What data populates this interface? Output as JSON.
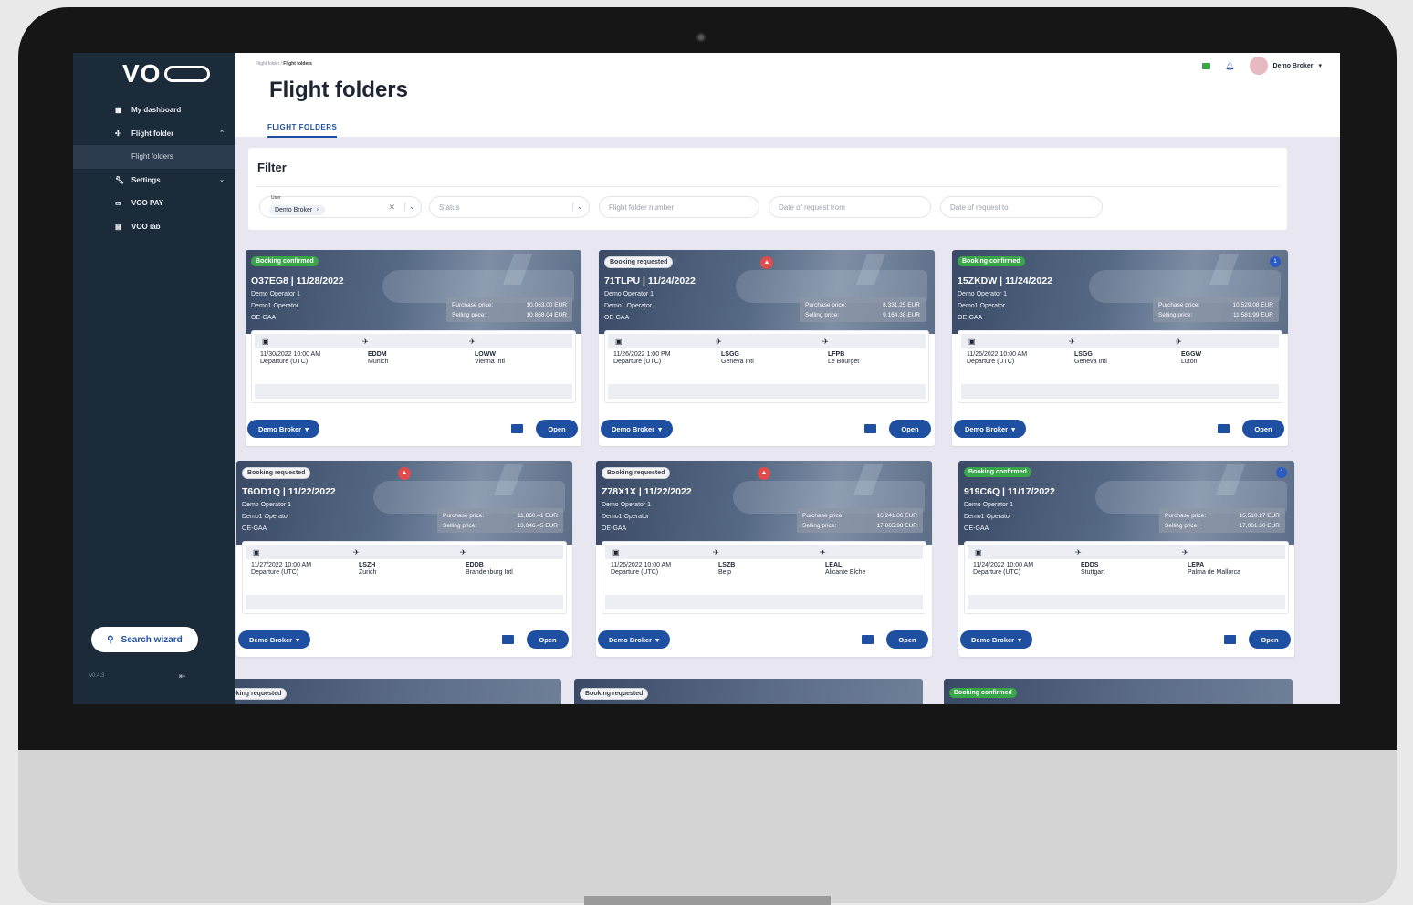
{
  "sidebar": {
    "logo": "VO",
    "items": [
      {
        "label": "My dashboard",
        "icon": "dashboard-icon"
      },
      {
        "label": "Flight folder",
        "icon": "flight-folder-icon"
      },
      {
        "label": "Flight folders",
        "icon": ""
      },
      {
        "label": "Settings",
        "icon": "wrench-icon"
      },
      {
        "label": "VOO PAY",
        "icon": "card-icon"
      },
      {
        "label": "VOO lab",
        "icon": "lab-icon"
      }
    ],
    "search_wizard": "Search wizard",
    "version": "v0.4.3"
  },
  "header": {
    "breadcrumb_parent": "Flight folder",
    "breadcrumb_sep": "/",
    "breadcrumb_current": "Flight folders",
    "title": "Flight folders",
    "tab": "FLIGHT FOLDERS",
    "user": "Demo Broker"
  },
  "filter": {
    "title": "Filter",
    "user_caption": "User",
    "user_chip": "Demo Broker",
    "status_placeholder": "Status",
    "number_placeholder": "Flight folder number",
    "from_placeholder": "Date of request from",
    "to_placeholder": "Date of request to"
  },
  "labels": {
    "purchase": "Purchase price:",
    "selling": "Selling price:",
    "departure": "Departure (UTC)",
    "broker": "Demo Broker",
    "open": "Open"
  },
  "cards": [
    {
      "status": "Booking confirmed",
      "title": "O37EG8 | 11/28/2022",
      "op1": "Demo Operator 1",
      "op2": "Demo1 Operator",
      "reg": "OE-GAA",
      "purchase": "10,063.00 EUR",
      "selling": "10,868.04 EUR",
      "date": "11/30/2022 10:00 AM",
      "from_code": "EDDM",
      "from_name": "Munich",
      "to_code": "LOWW",
      "to_name": "Vienna Intl",
      "alert": false,
      "count": ""
    },
    {
      "status": "Booking requested",
      "title": "71TLPU | 11/24/2022",
      "op1": "Demo Operator 1",
      "op2": "Demo1 Operator",
      "reg": "OE-GAA",
      "purchase": "8,331.25 EUR",
      "selling": "9,164.38 EUR",
      "date": "11/26/2022 1:00 PM",
      "from_code": "LSGG",
      "from_name": "Geneva Intl",
      "to_code": "LFPB",
      "to_name": "Le Bourget",
      "alert": true,
      "count": ""
    },
    {
      "status": "Booking confirmed",
      "title": "15ZKDW | 11/24/2022",
      "op1": "Demo Operator 1",
      "op2": "Demo1 Operator",
      "reg": "OE-GAA",
      "purchase": "10,529.08 EUR",
      "selling": "11,581.99 EUR",
      "date": "11/26/2022 10:00 AM",
      "from_code": "LSGG",
      "from_name": "Geneva Intl",
      "to_code": "EGGW",
      "to_name": "Luton",
      "alert": false,
      "count": "1"
    },
    {
      "status": "Booking requested",
      "title": "T6OD1Q | 11/22/2022",
      "op1": "Demo Operator 1",
      "op2": "Demo1 Operator",
      "reg": "OE-GAA",
      "purchase": "11,860.41 EUR",
      "selling": "13,046.45 EUR",
      "date": "11/27/2022 10:00 AM",
      "from_code": "LSZH",
      "from_name": "Zurich",
      "to_code": "EDDB",
      "to_name": "Brandenburg Intl",
      "alert": true,
      "count": ""
    },
    {
      "status": "Booking requested",
      "title": "Z78X1X | 11/22/2022",
      "op1": "Demo Operator 1",
      "op2": "Demo1 Operator",
      "reg": "OE-GAA",
      "purchase": "16,241.80 EUR",
      "selling": "17,865.98 EUR",
      "date": "11/26/2022 10:00 AM",
      "from_code": "LSZB",
      "from_name": "Belp",
      "to_code": "LEAL",
      "to_name": "Alicante Elche",
      "alert": true,
      "count": ""
    },
    {
      "status": "Booking confirmed",
      "title": "919C6Q | 11/17/2022",
      "op1": "Demo Operator 1",
      "op2": "Demo1 Operator",
      "reg": "OE-GAA",
      "purchase": "15,510.27 EUR",
      "selling": "17,061.30 EUR",
      "date": "11/24/2022 10:00 AM",
      "from_code": "EDDS",
      "from_name": "Stuttgart",
      "to_code": "LEPA",
      "to_name": "Palma de Mallorca",
      "alert": false,
      "count": "1"
    }
  ],
  "partial_cards": [
    {
      "status": "Booking requested"
    },
    {
      "status": "Booking requested"
    },
    {
      "status": "Booking confirmed"
    }
  ],
  "colors": {
    "accent": "#1f4fa0",
    "sidebar": "#1c2b3a",
    "confirmed": "#3aa64a",
    "alert": "#e24b4b"
  }
}
